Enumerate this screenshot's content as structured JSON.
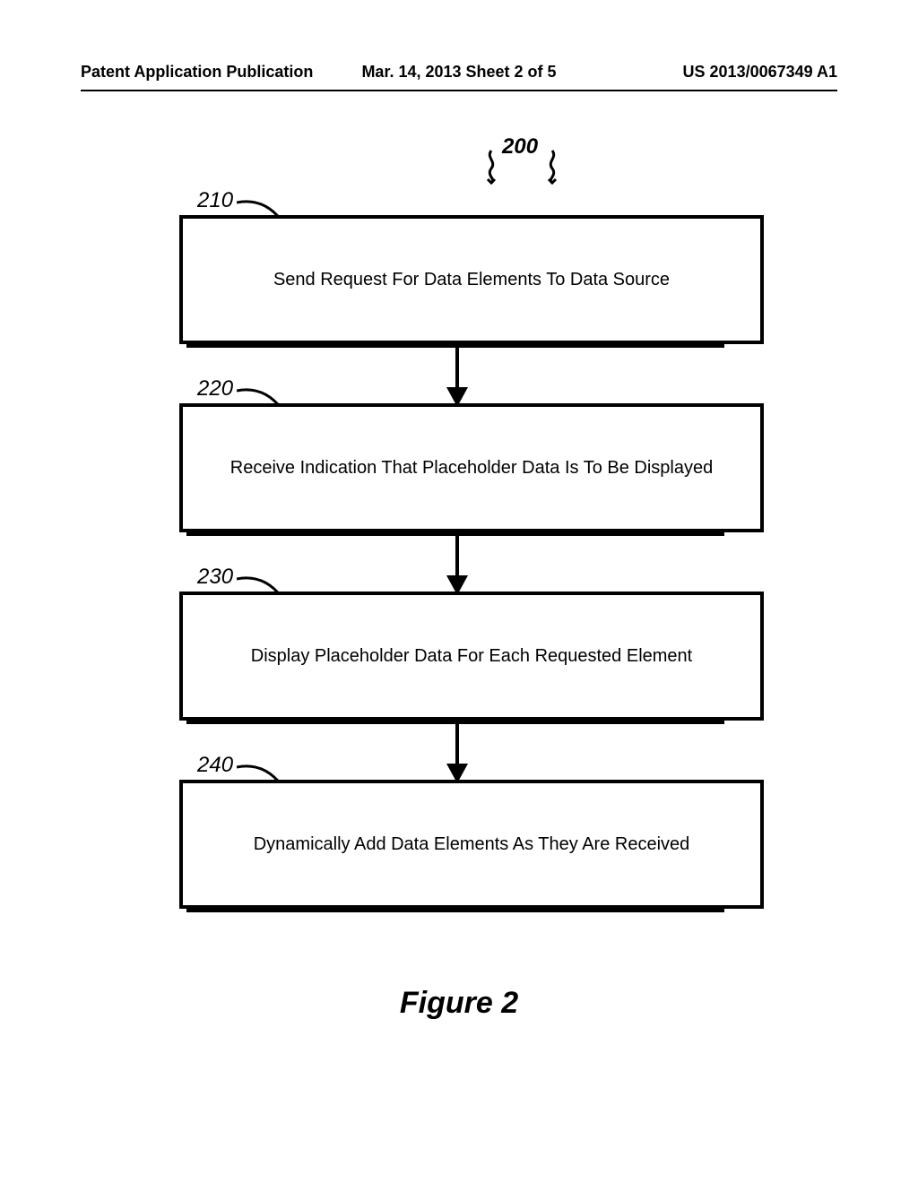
{
  "header": {
    "left": "Patent Application Publication",
    "center": "Mar. 14, 2013  Sheet 2 of 5",
    "right": "US 2013/0067349 A1"
  },
  "diagram_ref": "200",
  "steps": [
    {
      "ref": "210",
      "text": "Send Request For Data Elements To Data Source"
    },
    {
      "ref": "220",
      "text": "Receive Indication That Placeholder Data Is To Be Displayed"
    },
    {
      "ref": "230",
      "text": "Display Placeholder Data For Each Requested Element"
    },
    {
      "ref": "240",
      "text": "Dynamically Add Data Elements As They Are Received"
    }
  ],
  "figure_caption": "Figure 2",
  "chart_data": {
    "type": "flowchart",
    "title": "Figure 2",
    "reference": "200",
    "nodes": [
      {
        "id": "210",
        "label": "Send Request For Data Elements To Data Source"
      },
      {
        "id": "220",
        "label": "Receive Indication That Placeholder Data Is To Be Displayed"
      },
      {
        "id": "230",
        "label": "Display Placeholder Data For Each Requested Element"
      },
      {
        "id": "240",
        "label": "Dynamically Add Data Elements As They Are Received"
      }
    ],
    "edges": [
      {
        "from": "210",
        "to": "220"
      },
      {
        "from": "220",
        "to": "230"
      },
      {
        "from": "230",
        "to": "240"
      }
    ]
  }
}
